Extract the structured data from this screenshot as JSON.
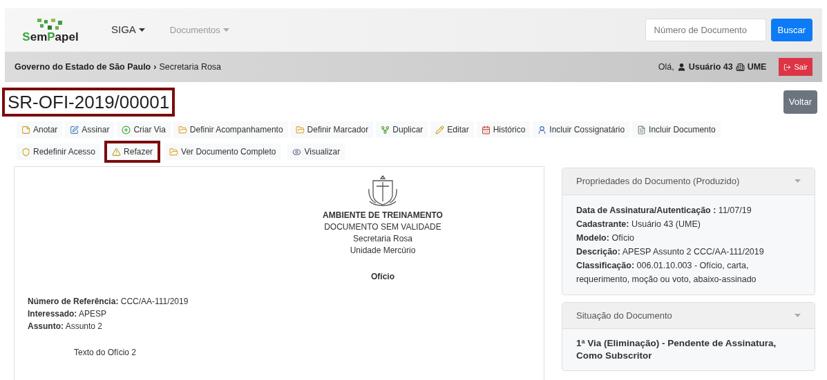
{
  "navbar": {
    "brand": {
      "first": "Sem",
      "second": "Papel"
    },
    "menus": [
      {
        "label": "SIGA",
        "muted": false
      },
      {
        "label": "Documentos",
        "muted": true
      }
    ],
    "search": {
      "placeholder": "Número de Documento"
    },
    "search_button": "Buscar"
  },
  "breadcrumb": {
    "org": "Governo do Estado de São Paulo",
    "separator": "›",
    "unit": "Secretaria Rosa"
  },
  "user": {
    "greeting": "Olá,",
    "name": "Usuário 43",
    "unit": "UME",
    "logout": "Sair"
  },
  "title": {
    "text": "SR-OFI-2019/00001",
    "highlighted": true
  },
  "back_button": "Voltar",
  "toolbar": [
    {
      "label": "Anotar",
      "kind": "note",
      "highlighted": false
    },
    {
      "label": "Assinar",
      "kind": "sign",
      "highlighted": false
    },
    {
      "label": "Criar Via",
      "kind": "plus",
      "highlighted": false
    },
    {
      "label": "Definir Acompanhamento",
      "kind": "folder",
      "highlighted": false
    },
    {
      "label": "Definir Marcador",
      "kind": "folder",
      "highlighted": false
    },
    {
      "label": "Duplicar",
      "kind": "fork",
      "highlighted": false
    },
    {
      "label": "Editar",
      "kind": "pencil",
      "highlighted": false
    },
    {
      "label": "Histórico",
      "kind": "calendar",
      "highlighted": false
    },
    {
      "label": "Incluir Cossignatário",
      "kind": "user",
      "highlighted": false
    },
    {
      "label": "Incluir Documento",
      "kind": "file",
      "highlighted": false
    },
    {
      "label": "Redefinir Acesso",
      "kind": "shield",
      "highlighted": false
    },
    {
      "label": "Refazer",
      "kind": "warning",
      "highlighted": true
    },
    {
      "label": "Ver Documento Completo",
      "kind": "folder",
      "highlighted": false
    },
    {
      "label": "Visualizar",
      "kind": "eye",
      "highlighted": false
    }
  ],
  "document": {
    "header": [
      "AMBIENTE DE TREINAMENTO",
      "DOCUMENTO SEM VALIDADE",
      "Secretaria Rosa",
      "Unidade Mercúrio"
    ],
    "doc_type": "Ofício",
    "fields": [
      {
        "label": "Número de Referência:",
        "value": "CCC/AA-111/2019"
      },
      {
        "label": "Interessado:",
        "value": "APESP"
      },
      {
        "label": "Assunto:",
        "value": "Assunto 2"
      }
    ],
    "body": "Texto do Ofício 2"
  },
  "properties_panel": {
    "title": "Propriedades do Documento (Produzido)",
    "expanded": true,
    "fields": [
      {
        "label": "Data de Assinatura/Autenticação :",
        "value": "11/07/19"
      },
      {
        "label": "Cadastrante:",
        "value": "Usuário 43 (UME)"
      },
      {
        "label": "Modelo:",
        "value": "Ofício"
      },
      {
        "label": "Descrição:",
        "value": "APESP Assunto 2 CCC/AA-111/2019"
      },
      {
        "label": "Classificação:",
        "value": "006.01.10.003 - Ofício, carta, requerimento, moção ou voto, abaixo-assinado"
      }
    ]
  },
  "status_panel": {
    "title": "Situação do Documento",
    "expanded": true,
    "status": "1ª Via (Eliminação) - Pendente de Assinatura, Como Subscritor"
  }
}
